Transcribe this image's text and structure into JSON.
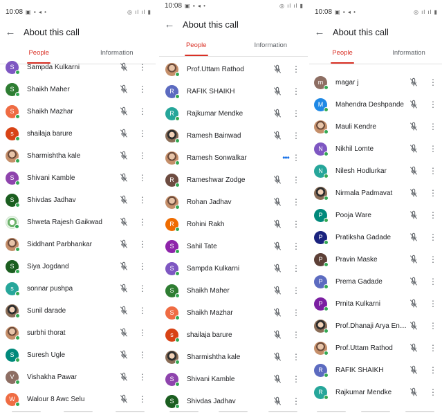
{
  "colors": {
    "accent": "#d93025",
    "online": "#34a853",
    "speaking": "#1a73e8"
  },
  "icons": {
    "back": "arrow-back-icon",
    "mic": "mic-off-icon",
    "more": "more-vert-icon",
    "speaking": "speaking-dots-icon"
  },
  "status": {
    "time": "10:08"
  },
  "header": {
    "title": "About this call"
  },
  "tabs": [
    {
      "label": "People"
    },
    {
      "label": "Information"
    }
  ],
  "panels": [
    {
      "participants": [
        {
          "name": "Sampda Kulkarni",
          "initial": "S",
          "color": "#7e57c2"
        },
        {
          "name": "Shaikh Maher",
          "initial": "S",
          "color": "#2e7d32"
        },
        {
          "name": "Shaikh Mazhar",
          "initial": "S",
          "color": "#ef6c43"
        },
        {
          "name": "shailaja barure",
          "initial": "s",
          "color": "#d84315"
        },
        {
          "name": "Sharmishtha kale",
          "initial": "",
          "color": "#a1887f",
          "photo": true
        },
        {
          "name": "Shivani Kamble",
          "initial": "S",
          "color": "#8e44ad"
        },
        {
          "name": "Shivdas Jadhav",
          "initial": "S",
          "color": "#1b5e20"
        },
        {
          "name": "Shweta Rajesh Gaikwad",
          "initial": "",
          "color": "#e8f4e8",
          "logo": true
        },
        {
          "name": "Siddhant Parbhankar",
          "initial": "",
          "color": "#bcaaa4",
          "photo": true
        },
        {
          "name": "Siya Jogdand",
          "initial": "S",
          "color": "#1b5e20"
        },
        {
          "name": "sonnar pushpa",
          "initial": "s",
          "color": "#26a69a"
        },
        {
          "name": "Sunil darade",
          "initial": "",
          "color": "#795548",
          "photo": true
        },
        {
          "name": "surbhi thorat",
          "initial": "",
          "color": "#6d4c41",
          "photo": true
        },
        {
          "name": "Suresh Ugle",
          "initial": "S",
          "color": "#00897b"
        },
        {
          "name": "Vishakha Pawar",
          "initial": "V",
          "color": "#8d6e63"
        },
        {
          "name": "Walour 8 Awc Selu",
          "initial": "W",
          "color": "#ef6c43"
        }
      ]
    },
    {
      "participants": [
        {
          "name": "Prof.Uttam Rathod",
          "initial": "",
          "color": "#a1887f",
          "photo": true
        },
        {
          "name": "RAFIK SHAIKH",
          "initial": "R",
          "color": "#5c6bc0"
        },
        {
          "name": "Rajkumar Mendke",
          "initial": "R",
          "color": "#26a69a"
        },
        {
          "name": "Ramesh Bainwad",
          "initial": "",
          "color": "#795548",
          "photo": true
        },
        {
          "name": "Ramesh Sonwalkar",
          "initial": "",
          "color": "#37474f",
          "photo": true,
          "speaking": true
        },
        {
          "name": "Rameshwar Zodge",
          "initial": "R",
          "color": "#6d4c41"
        },
        {
          "name": "Rohan Jadhav",
          "initial": "",
          "color": "#212121",
          "photo": true
        },
        {
          "name": "Rohini Rakh",
          "initial": "R",
          "color": "#ef6c00"
        },
        {
          "name": "Sahil Tate",
          "initial": "S",
          "color": "#8e24aa"
        },
        {
          "name": "Sampda Kulkarni",
          "initial": "S",
          "color": "#7e57c2"
        },
        {
          "name": "Shaikh Maher",
          "initial": "S",
          "color": "#2e7d32"
        },
        {
          "name": "Shaikh Mazhar",
          "initial": "S",
          "color": "#ef6c43"
        },
        {
          "name": "shailaja barure",
          "initial": "s",
          "color": "#d84315"
        },
        {
          "name": "Sharmishtha kale",
          "initial": "",
          "color": "#a1887f",
          "photo": true
        },
        {
          "name": "Shivani Kamble",
          "initial": "S",
          "color": "#8e44ad"
        },
        {
          "name": "Shivdas Jadhav",
          "initial": "S",
          "color": "#1b5e20"
        }
      ]
    },
    {
      "participants": [
        {
          "name": "magar j",
          "initial": "m",
          "color": "#8d6e63"
        },
        {
          "name": "Mahendra Deshpande",
          "initial": "M",
          "color": "#1e88e5"
        },
        {
          "name": "Mauli Kendre",
          "initial": "",
          "color": "#5d4037",
          "photo": true
        },
        {
          "name": "Nikhil Lomte",
          "initial": "N",
          "color": "#7e57c2"
        },
        {
          "name": "Nilesh Hodlurkar",
          "initial": "N",
          "color": "#26a69a"
        },
        {
          "name": "Nirmala Padmavat",
          "initial": "",
          "color": "#a1887f",
          "photo": true
        },
        {
          "name": "Pooja Ware",
          "initial": "P",
          "color": "#00897b"
        },
        {
          "name": "Pratiksha Gadade",
          "initial": "P",
          "color": "#1a237e"
        },
        {
          "name": "Pravin Maske",
          "initial": "P",
          "color": "#5d4037"
        },
        {
          "name": "Prema Gadade",
          "initial": "P",
          "color": "#5c6bc0"
        },
        {
          "name": "Prnita Kulkarni",
          "initial": "P",
          "color": "#7b1fa2"
        },
        {
          "name": "Prof.Dhanaji Arya English ...",
          "initial": "",
          "color": "#f9a825",
          "photo": true
        },
        {
          "name": "Prof.Uttam Rathod",
          "initial": "",
          "color": "#a1887f",
          "photo": true
        },
        {
          "name": "RAFIK SHAIKH",
          "initial": "R",
          "color": "#5c6bc0"
        },
        {
          "name": "Rajkumar Mendke",
          "initial": "R",
          "color": "#26a69a"
        }
      ]
    }
  ]
}
